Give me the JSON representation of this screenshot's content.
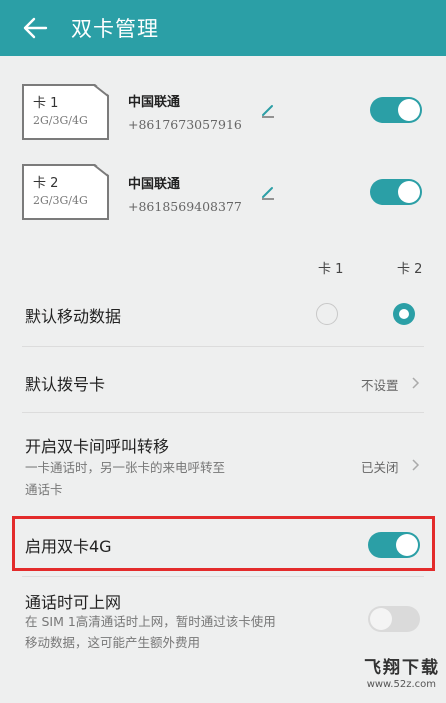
{
  "header": {
    "title": "双卡管理",
    "back_icon": "arrow-left-icon",
    "color": "#2b9fa6"
  },
  "sims": [
    {
      "name": "卡 1",
      "network": "2G/3G/4G",
      "carrier": "中国联通",
      "phone": "+8617673057916",
      "enabled": true
    },
    {
      "name": "卡 2",
      "network": "2G/3G/4G",
      "carrier": "中国联通",
      "phone": "+8618569408377",
      "enabled": true
    }
  ],
  "columns": {
    "sim1": "卡 1",
    "sim2": "卡 2"
  },
  "default_data": {
    "title": "默认移动数据",
    "selected": "卡 2"
  },
  "default_dial": {
    "title": "默认拨号卡",
    "value": "不设置"
  },
  "call_forward": {
    "title": "开启双卡间呼叫转移",
    "subtitle_line1": "一卡通话时，另一张卡的来电呼转至",
    "subtitle_line2": "通话卡",
    "value": "已关闭"
  },
  "dual_4g": {
    "title": "启用双卡4G",
    "enabled": true
  },
  "call_internet": {
    "title": "通话时可上网",
    "subtitle_line1": "在 SIM 1高清通话时上网，暂时通过该卡使用",
    "subtitle_line2": "移动数据，这可能产生额外费用",
    "enabled": false
  },
  "watermark": {
    "brand": "飞翔下载",
    "url": "www.52z.com"
  },
  "colors": {
    "accent": "#2b9fa6",
    "highlight_border": "#e32b2b",
    "background": "#eeefef"
  }
}
